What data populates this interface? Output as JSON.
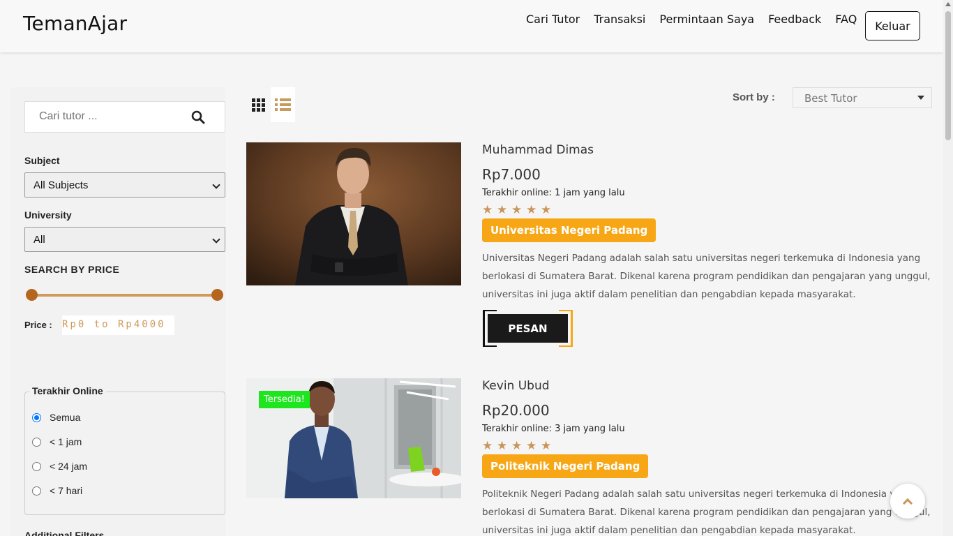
{
  "brand": "TemanAjar",
  "nav": {
    "items": [
      "Cari Tutor",
      "Transaksi",
      "Permintaan Saya",
      "Feedback",
      "FAQ"
    ],
    "logout_label": "Keluar"
  },
  "sidebar": {
    "search_placeholder": "Cari tutor ...",
    "subject_label": "Subject",
    "subject_value": "All Subjects",
    "university_label": "University",
    "university_value": "All",
    "price_heading": "SEARCH BY PRICE",
    "price_label": "Price :",
    "price_value": "Rp0 to Rp4000",
    "price_range": {
      "min": 0,
      "max": 4000
    },
    "online_legend": "Terakhir Online",
    "online_options": [
      "Semua",
      "< 1 jam",
      "< 24 jam",
      "< 7 hari"
    ],
    "online_selected": "Semua",
    "additional_filters": "Additional Filters"
  },
  "toolbar": {
    "sort_label": "Sort by :",
    "sort_value": "Best Tutor",
    "active_view": "list"
  },
  "tutors": [
    {
      "name": "Muhammad Dimas",
      "price": "Rp7.000",
      "last_online": "Terakhir online: 1 jam yang lalu",
      "rating": 5,
      "university": "Universitas Negeri Padang",
      "description": "Universitas Negeri Padang adalah salah satu universitas negeri terkemuka di Indonesia yang berlokasi di Sumatera Barat. Dikenal karena program pendidikan dan pengajaran yang unggul, universitas ini juga aktif dalam penelitian dan pengabdian kepada masyarakat.",
      "button": "PESAN"
    },
    {
      "name": "Kevin Ubud",
      "price": "Rp20.000",
      "last_online": "Terakhir online: 3 jam yang lalu",
      "rating": 5,
      "university": "Politeknik Negeri Padang",
      "badge": "Tersedia!",
      "description": "Politeknik Negeri Padang adalah salah satu universitas negeri terkemuka di Indonesia yang berlokasi di Sumatera Barat. Dikenal karena program pendidikan dan pengajaran yang unggul, universitas ini juga aktif dalam penelitian dan pengabdian kepada masyarakat."
    }
  ],
  "colors": {
    "accent": "#f7a716",
    "star": "#c9955a",
    "slider": "#d09a5a",
    "available": "#1ee61e"
  }
}
